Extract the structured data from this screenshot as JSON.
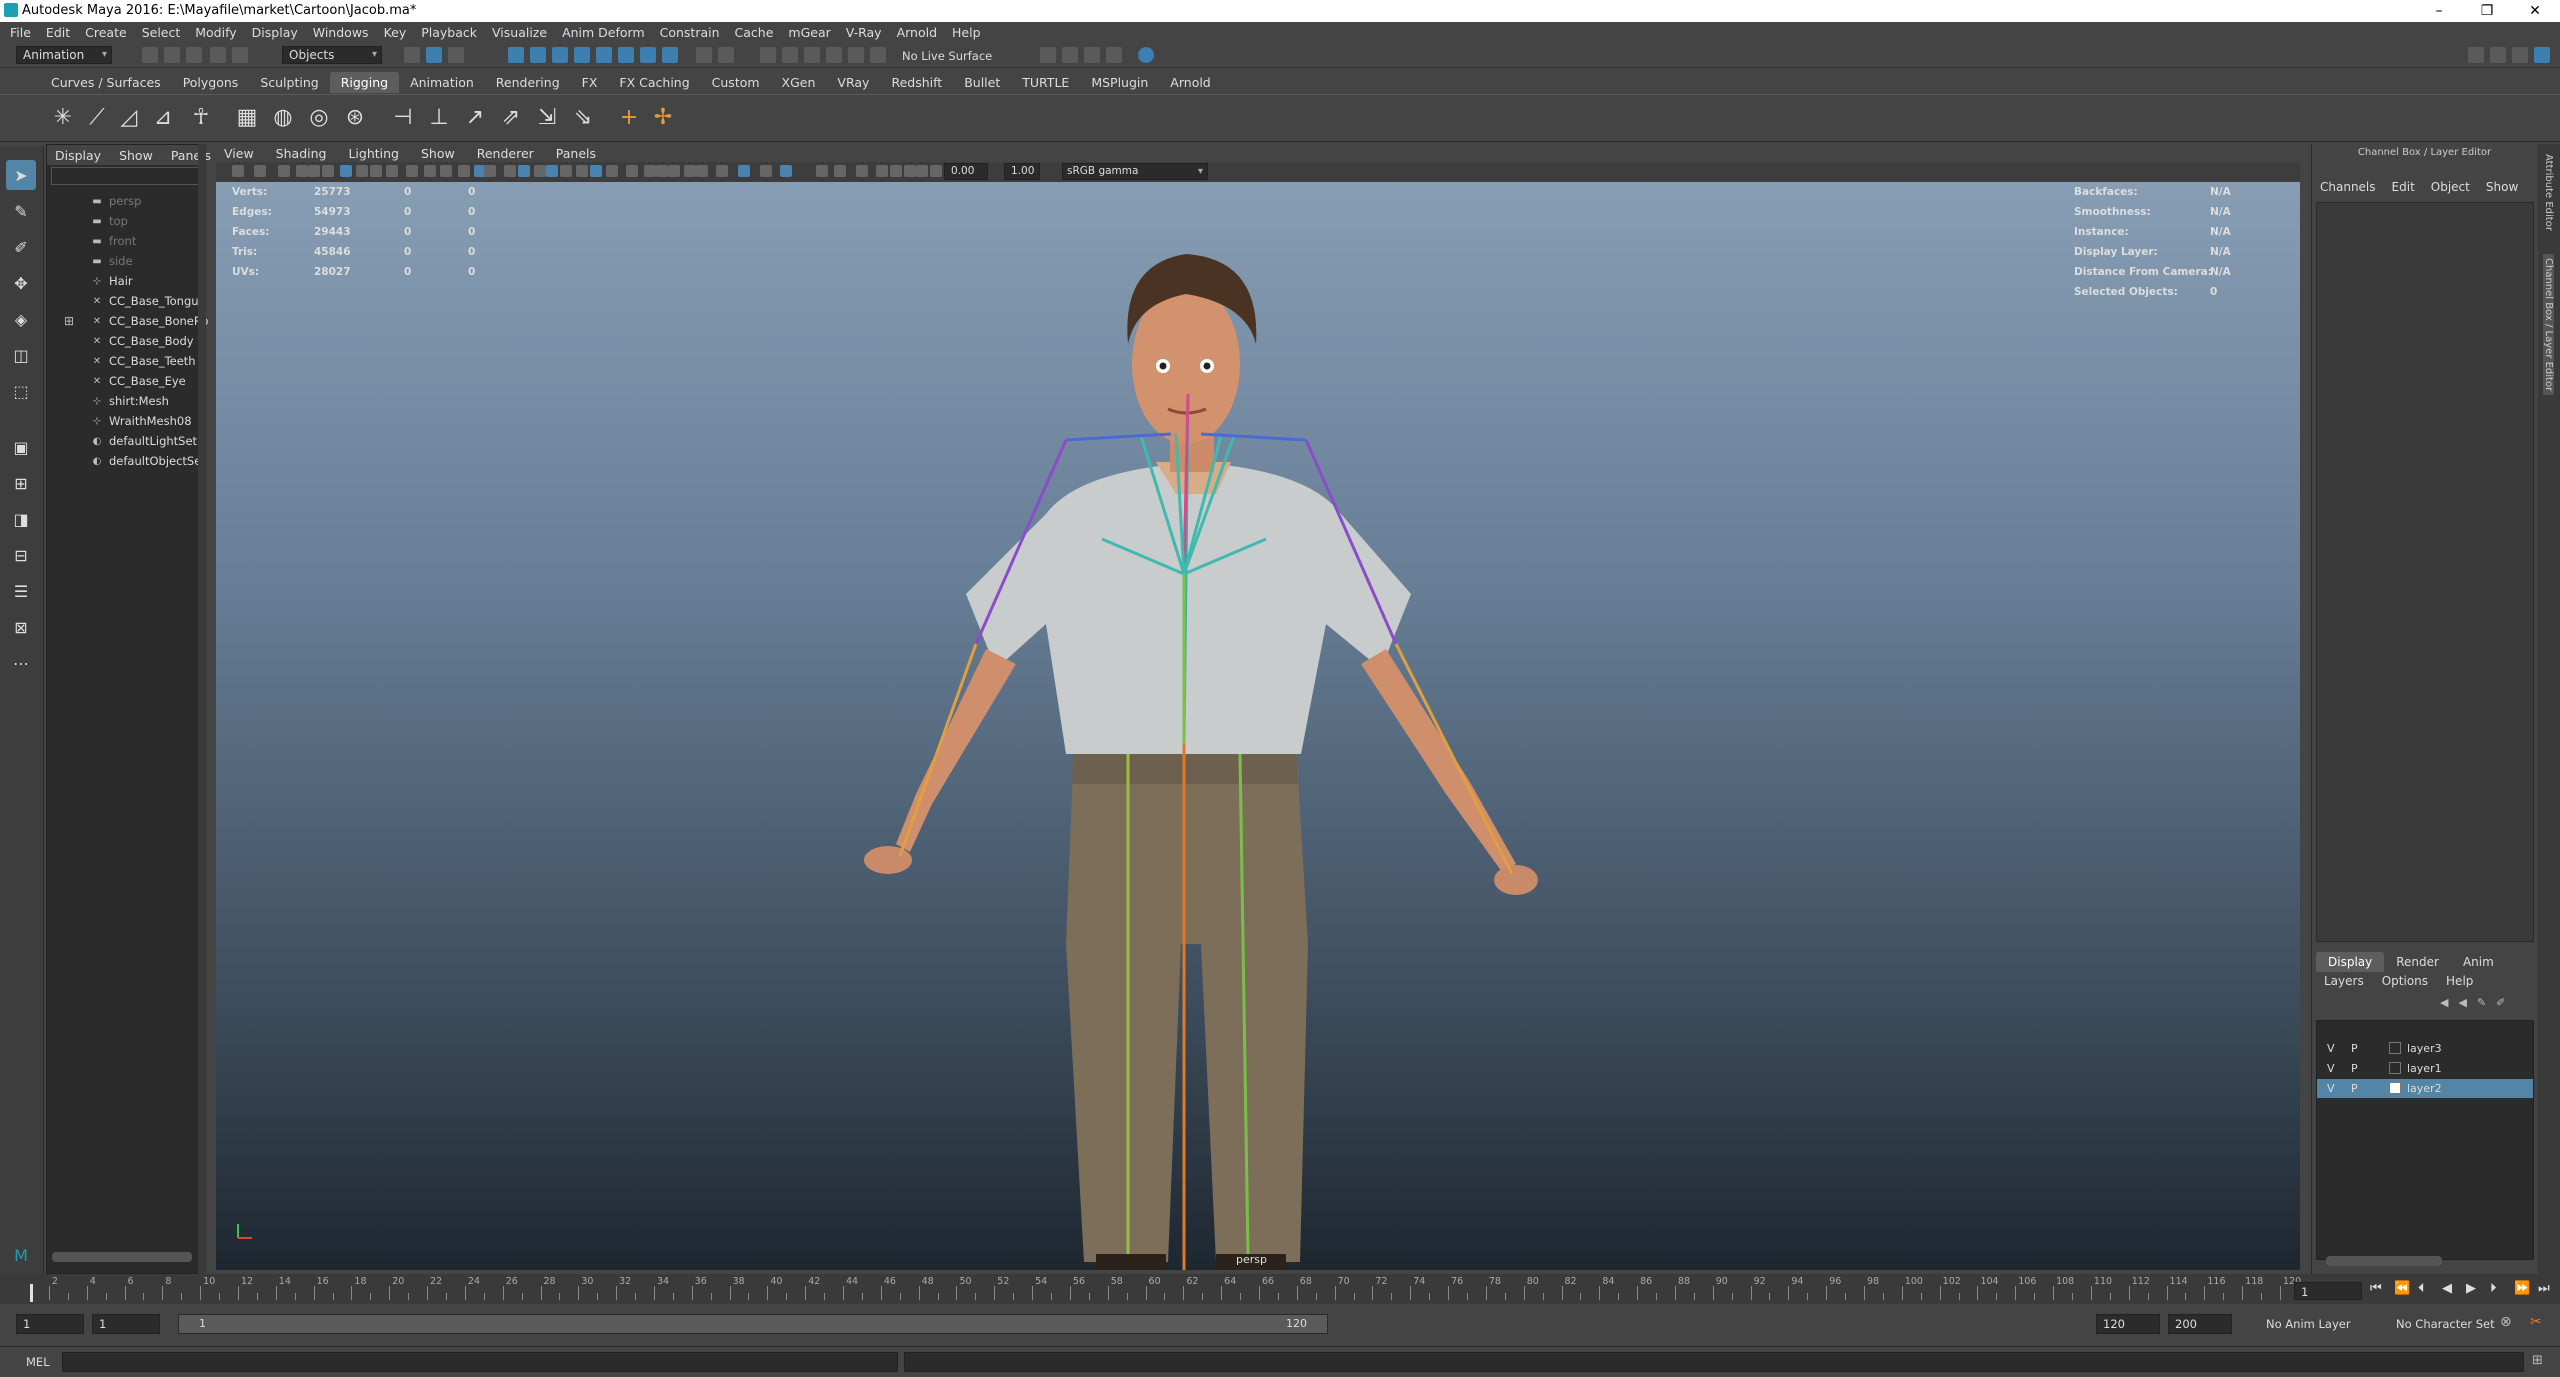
{
  "window": {
    "title": "Autodesk Maya 2016: E:\\Mayafile\\market\\Cartoon\\Jacob.ma*",
    "min": "–",
    "restore": "❐",
    "close": "✕"
  },
  "menubar": [
    "File",
    "Edit",
    "Create",
    "Select",
    "Modify",
    "Display",
    "Windows",
    "Key",
    "Playback",
    "Visualize",
    "Anim Deform",
    "Constrain",
    "Cache",
    "mGear",
    "V-Ray",
    "Arnold",
    "Help"
  ],
  "statusline": {
    "menuset": "Animation",
    "selection_mode": "Objects",
    "live_surface": "No Live Surface"
  },
  "shelf_tabs": [
    "Curves / Surfaces",
    "Polygons",
    "Sculpting",
    "Rigging",
    "Animation",
    "Rendering",
    "FX",
    "FX Caching",
    "Custom",
    "XGen",
    "VRay",
    "Redshift",
    "Bullet",
    "TURTLE",
    "MSPlugin",
    "Arnold"
  ],
  "shelf_active": "Rigging",
  "outliner": {
    "menu": [
      "Display",
      "Show",
      "Panels"
    ],
    "items": [
      {
        "label": "persp",
        "icon": "camera-icon",
        "dim": true
      },
      {
        "label": "top",
        "icon": "camera-icon",
        "dim": true
      },
      {
        "label": "front",
        "icon": "camera-icon",
        "dim": true
      },
      {
        "label": "side",
        "icon": "camera-icon",
        "dim": true
      },
      {
        "label": "Hair",
        "icon": "mesh-icon",
        "dim": false
      },
      {
        "label": "CC_Base_Tongue",
        "icon": "joint-icon",
        "dim": false
      },
      {
        "label": "CC_Base_BoneRo",
        "icon": "joint-icon",
        "dim": false,
        "expandable": true
      },
      {
        "label": "CC_Base_Body",
        "icon": "joint-icon",
        "dim": false
      },
      {
        "label": "CC_Base_Teeth",
        "icon": "joint-icon",
        "dim": false
      },
      {
        "label": "CC_Base_Eye",
        "icon": "joint-icon",
        "dim": false
      },
      {
        "label": "shirt:Mesh",
        "icon": "mesh-icon",
        "dim": false
      },
      {
        "label": "WraithMesh08",
        "icon": "mesh-icon",
        "dim": false
      },
      {
        "label": "defaultLightSet",
        "icon": "set-icon",
        "dim": false
      },
      {
        "label": "defaultObjectSet",
        "icon": "set-icon",
        "dim": false
      }
    ]
  },
  "viewport": {
    "menu": [
      "View",
      "Shading",
      "Lighting",
      "Show",
      "Renderer",
      "Panels"
    ],
    "exposure": "0.00",
    "gamma": "1.00",
    "colorspace": "sRGB gamma",
    "camera_label": "persp",
    "hud_left": [
      {
        "label": "Verts:",
        "v1": "25773",
        "v2": "0",
        "v3": "0"
      },
      {
        "label": "Edges:",
        "v1": "54973",
        "v2": "0",
        "v3": "0"
      },
      {
        "label": "Faces:",
        "v1": "29443",
        "v2": "0",
        "v3": "0"
      },
      {
        "label": "Tris:",
        "v1": "45846",
        "v2": "0",
        "v3": "0"
      },
      {
        "label": "UVs:",
        "v1": "28027",
        "v2": "0",
        "v3": "0"
      }
    ],
    "hud_right": [
      {
        "label": "Backfaces:",
        "value": "N/A"
      },
      {
        "label": "Smoothness:",
        "value": "N/A"
      },
      {
        "label": "Instance:",
        "value": "N/A"
      },
      {
        "label": "Display Layer:",
        "value": "N/A"
      },
      {
        "label": "Distance From Camera:",
        "value": "N/A"
      },
      {
        "label": "Selected Objects:",
        "value": "0"
      }
    ]
  },
  "channel_box": {
    "title": "Channel Box / Layer Editor",
    "menu": [
      "Channels",
      "Edit",
      "Object",
      "Show"
    ],
    "layer_tabs": [
      "Display",
      "Render",
      "Anim"
    ],
    "layer_menu": [
      "Layers",
      "Options",
      "Help"
    ],
    "layers": [
      {
        "v": "V",
        "p": "P",
        "name": "layer3",
        "selected": false
      },
      {
        "v": "V",
        "p": "P",
        "name": "layer1",
        "selected": false
      },
      {
        "v": "V",
        "p": "P",
        "name": "layer2",
        "selected": true
      }
    ]
  },
  "side_strip": {
    "attr_editor": "Attribute Editor",
    "channel_box": "Channel Box / Layer Editor"
  },
  "timeline": {
    "ticks": [
      "2",
      "4",
      "6",
      "8",
      "10",
      "12",
      "14",
      "16",
      "18",
      "20",
      "22",
      "24",
      "26",
      "28",
      "30",
      "32",
      "34",
      "36",
      "38",
      "40",
      "42",
      "44",
      "46",
      "48",
      "50",
      "52",
      "54",
      "56",
      "58",
      "60",
      "62",
      "64",
      "66",
      "68",
      "70",
      "72",
      "74",
      "76",
      "78",
      "80",
      "82",
      "84",
      "86",
      "88",
      "90",
      "92",
      "94",
      "96",
      "98",
      "100",
      "102",
      "104",
      "106",
      "108",
      "110",
      "112",
      "114",
      "116",
      "118",
      "120"
    ],
    "current_frame": "1"
  },
  "range": {
    "start": "1",
    "playback_start": "1",
    "slider_start": "1",
    "slider_end": "120",
    "playback_end": "120",
    "end": "200",
    "anim_layer": "No Anim Layer",
    "character_set": "No Character Set"
  },
  "command": {
    "lang": "MEL"
  },
  "colors": {
    "accent": "#5285a6",
    "viewport_top": "#8aa0b7",
    "viewport_bottom": "#1e2730"
  }
}
